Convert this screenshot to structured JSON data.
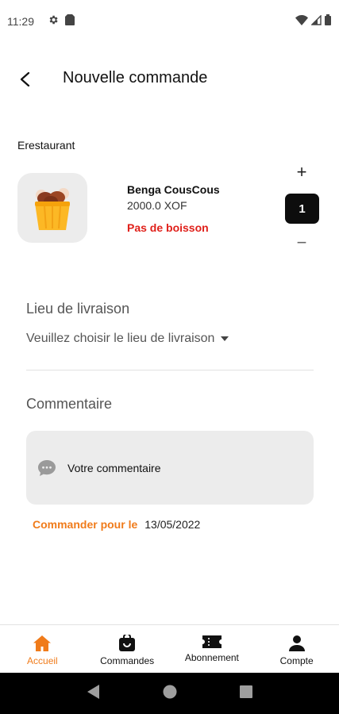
{
  "status_bar": {
    "time": "11:29"
  },
  "header": {
    "title": "Nouvelle commande"
  },
  "restaurant": {
    "name": "Erestaurant"
  },
  "product": {
    "name": "Benga CousCous",
    "price": "2000.0 XOF",
    "note": "Pas de boisson",
    "quantity": "1",
    "plus_label": "+",
    "minus_label": "−"
  },
  "delivery": {
    "label": "Lieu de livraison",
    "placeholder": "Veuillez choisir le lieu de livraison"
  },
  "comment": {
    "label": "Commentaire",
    "placeholder": "Votre commentaire"
  },
  "order_for": {
    "label": "Commander pour le",
    "date": "13/05/2022"
  },
  "bottom_nav": {
    "items": [
      {
        "label": "Accueil",
        "icon": "home-icon",
        "active": true
      },
      {
        "label": "Commandes",
        "icon": "bag-icon",
        "active": false
      },
      {
        "label": "Abonnement",
        "icon": "ticket-icon",
        "active": false
      },
      {
        "label": "Compte",
        "icon": "person-icon",
        "active": false
      }
    ]
  },
  "colors": {
    "accent": "#f07b1a",
    "warning": "#e0201a",
    "quantity_bg": "#0d0d0d",
    "surface": "#ececec"
  }
}
